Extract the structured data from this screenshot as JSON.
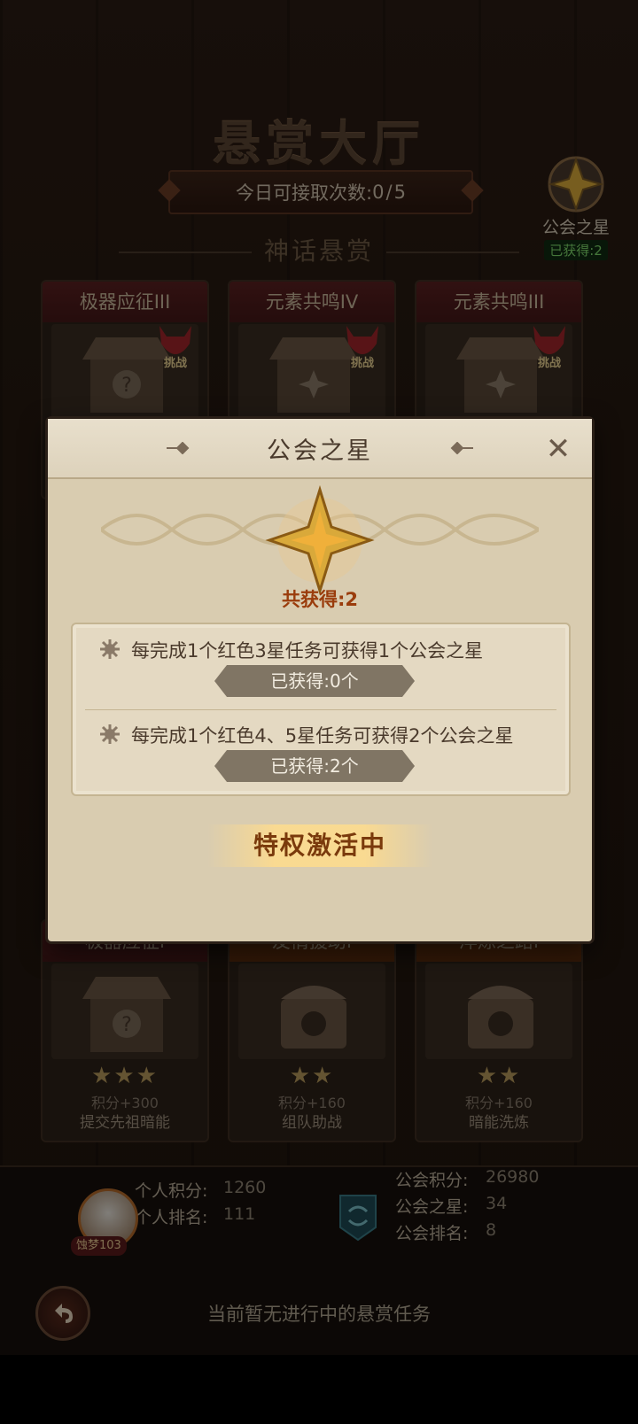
{
  "header": {
    "hall_title": "悬赏大厅",
    "quota_label": "今日可接取次数:",
    "quota_used": "0",
    "quota_total": "5",
    "section_title": "神话悬赏"
  },
  "guild_star_badge": {
    "label": "公会之星",
    "obtained": "已获得:2"
  },
  "cards_top": [
    {
      "title": "极器应征III",
      "challenge": "挑战"
    },
    {
      "title": "元素共鸣IV",
      "challenge": "挑战"
    },
    {
      "title": "元素共鸣III",
      "challenge": "挑战"
    }
  ],
  "cards_bottom": [
    {
      "title": "极器应征I",
      "stars": "★★★",
      "points": "积分+300",
      "desc": "提交先祖暗能"
    },
    {
      "title": "友情援助I",
      "stars": "★★",
      "points": "积分+160",
      "desc": "组队助战"
    },
    {
      "title": "淬炼之路I",
      "stars": "★★",
      "points": "积分+160",
      "desc": "暗能洗炼"
    }
  ],
  "modal": {
    "title": "公会之星",
    "close": "✕",
    "total": "共获得:2",
    "rules": [
      {
        "text": "每完成1个红色3星任务可获得1个公会之星",
        "obtained": "已获得:0个"
      },
      {
        "text": "每完成1个红色4、5星任务可获得2个公会之星",
        "obtained": "已获得:2个"
      }
    ],
    "activate": "特权激活中"
  },
  "footer": {
    "personal_points_label": "个人积分:",
    "personal_points": "1260",
    "personal_rank_label": "个人排名:",
    "personal_rank": "111",
    "level_tag": "蚀梦103",
    "guild_points_label": "公会积分:",
    "guild_points": "26980",
    "guild_stars_label": "公会之星:",
    "guild_stars": "34",
    "guild_rank_label": "公会排名:",
    "guild_rank": "8",
    "no_task": "当前暂无进行中的悬赏任务"
  },
  "colors": {
    "accent_gold": "#d9a93a",
    "challenge_red": "#c0302a",
    "obtained_green": "#7fd86b"
  }
}
